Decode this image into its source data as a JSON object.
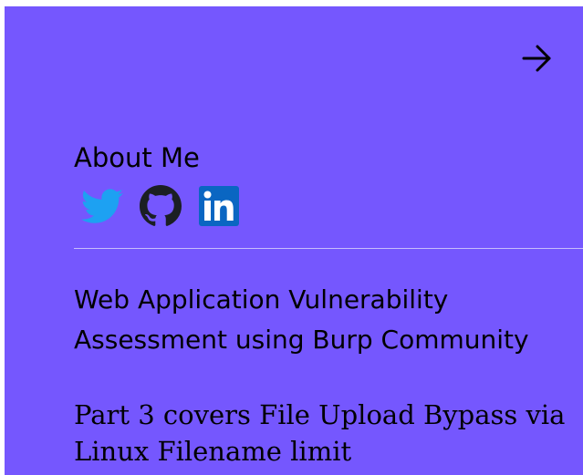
{
  "navigation": {
    "next_icon": "arrow-right-icon"
  },
  "about": {
    "heading": "About Me",
    "social": [
      {
        "name": "Twitter",
        "icon": "twitter-icon",
        "color": "#1da1f2"
      },
      {
        "name": "GitHub",
        "icon": "github-icon",
        "color": "#1b1f23"
      },
      {
        "name": "LinkedIn",
        "icon": "linkedin-icon",
        "color": "#0a66c2"
      }
    ]
  },
  "post": {
    "title": "Web Application Vulnerability Assessment using Burp Community",
    "excerpt": "Part 3 covers File Upload Bypass via Linux Filename limit"
  },
  "colors": {
    "panel_background": "#7557fe",
    "text": "#000000",
    "divider": "#c8bdfc"
  }
}
